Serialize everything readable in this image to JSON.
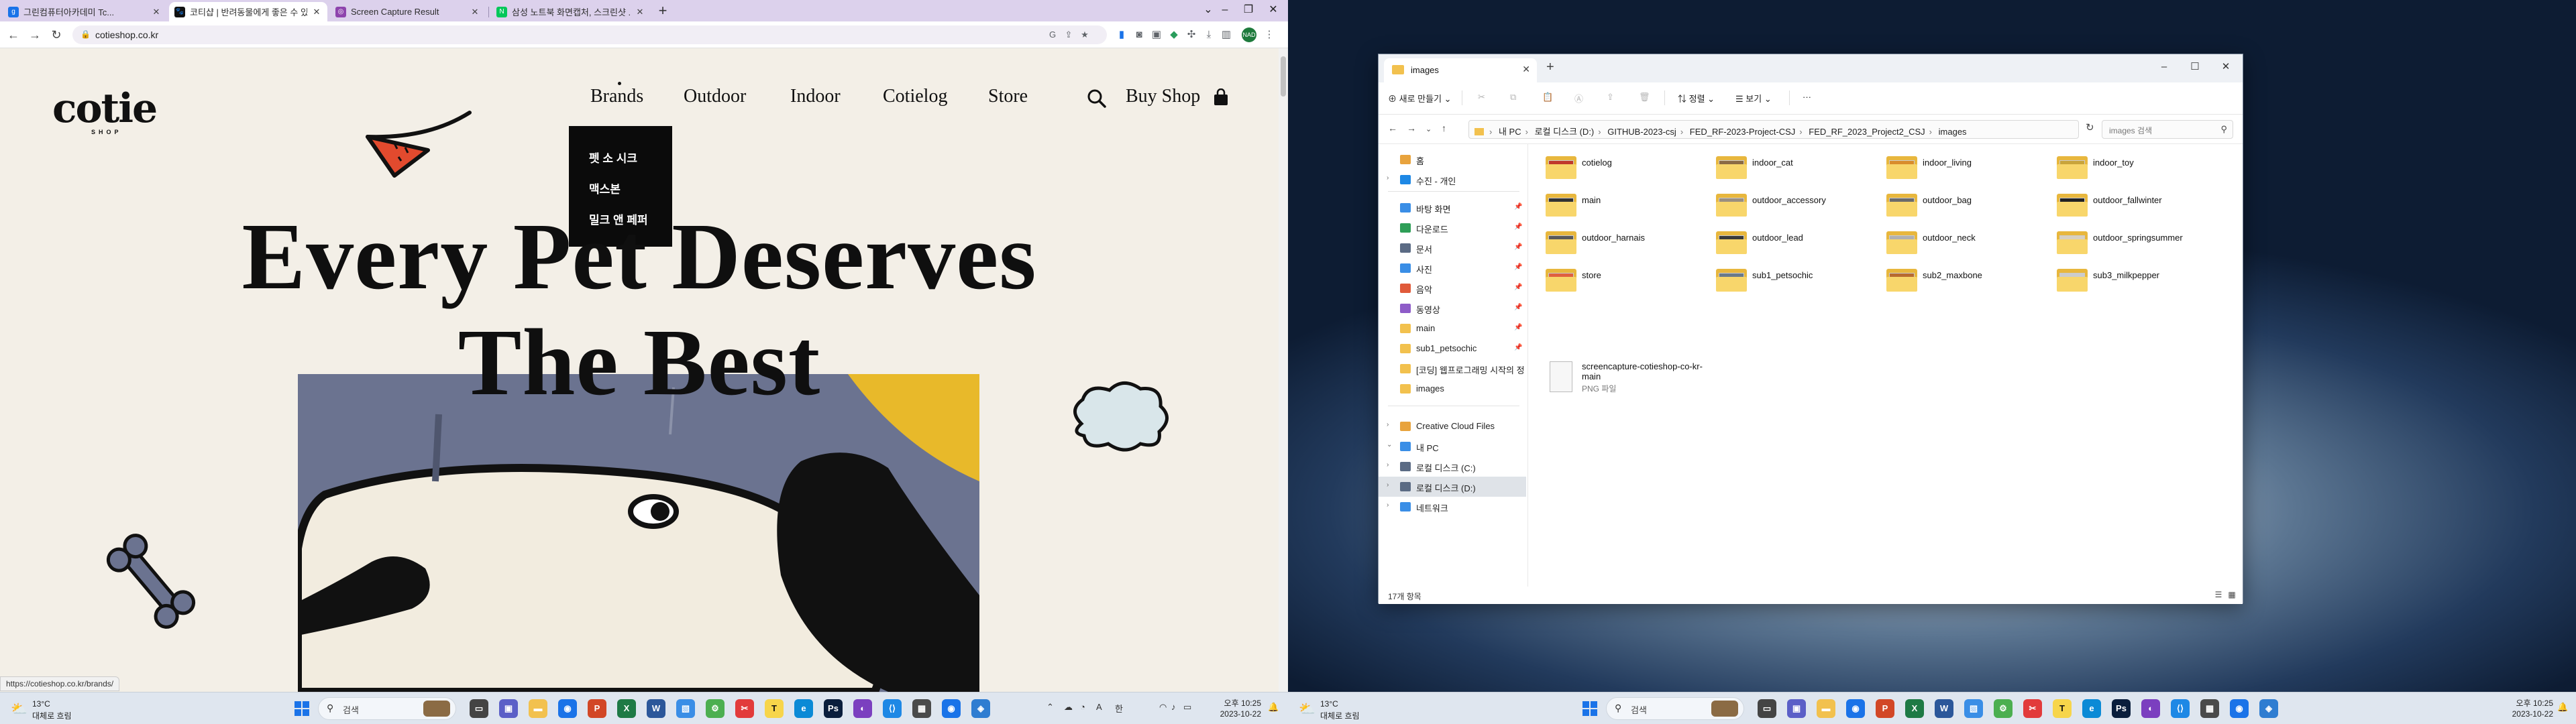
{
  "chrome": {
    "tabs": [
      {
        "title": "그린컴퓨터아카데미 Tc...",
        "icon_color": "#1a73e8"
      },
      {
        "title": "코티샵 | 반려동물에게 좋은 수 있...",
        "icon_color": "#111111"
      },
      {
        "title": "Screen Capture Result",
        "icon_color": "#8e44ad"
      },
      {
        "title": "삼성 노트북 화면캡처, 스크린샷 ...",
        "icon_color": "#03c75a"
      }
    ],
    "active_tab": 1,
    "url": "cotieshop.co.kr",
    "profile_initials": "NAD",
    "status_url": "https://cotieshop.co.kr/brands/"
  },
  "site": {
    "logo_word": "cotie",
    "logo_sub": "SHOP",
    "nav": [
      "Brands",
      "Outdoor",
      "Indoor",
      "Cotielog",
      "Store"
    ],
    "buy_label": "Buy Shop",
    "brands_dropdown": [
      "펫 소 시크",
      "맥스본",
      "밀크 앤 페퍼"
    ],
    "hero_line1": "Every Pet Deserves",
    "hero_line2": "The Best",
    "accent_colors": {
      "navy": "#6b7390",
      "yellow": "#e8b92a",
      "cream": "#f2ecdf"
    }
  },
  "taskbar_left": {
    "weather_temp": "13°C",
    "weather_text": "대체로 흐림",
    "search_placeholder": "검색",
    "time": "오후 10:25",
    "date": "2023-10-22",
    "ime": "한"
  },
  "taskbar_right": {
    "weather_temp": "13°C",
    "weather_text": "대체로 흐림",
    "search_placeholder": "검색",
    "time": "오후 10:25",
    "date": "2023-10-22"
  },
  "explorer": {
    "tab_title": "images",
    "commands": {
      "new": "새로 만들기",
      "sort": "정렬",
      "view": "보기",
      "more": "···"
    },
    "breadcrumbs": [
      "내 PC",
      "로컬 디스크 (D:)",
      "GITHUB-2023-csj",
      "FED_RF-2023-Project-CSJ",
      "FED_RF_2023_Project2_CSJ",
      "images"
    ],
    "search_placeholder": "images 검색",
    "nav_items": [
      {
        "label": "홈",
        "icon": "home-icon",
        "color": "#e8a33d",
        "pin": false,
        "chev": false
      },
      {
        "label": "수진 - 개인",
        "icon": "cloud-icon",
        "color": "#1e88e5",
        "pin": false,
        "chev": true
      },
      {
        "label": "바탕 화면",
        "icon": "desktop-icon",
        "color": "#3a8ee6",
        "pin": true,
        "chev": false
      },
      {
        "label": "다운로드",
        "icon": "download-icon",
        "color": "#2e9e57",
        "pin": true,
        "chev": false
      },
      {
        "label": "문서",
        "icon": "document-icon",
        "color": "#5b6b84",
        "pin": true,
        "chev": false
      },
      {
        "label": "사진",
        "icon": "photo-icon",
        "color": "#3a8ee6",
        "pin": true,
        "chev": false
      },
      {
        "label": "음악",
        "icon": "music-icon",
        "color": "#e05a3a",
        "pin": true,
        "chev": false
      },
      {
        "label": "동영상",
        "icon": "video-icon",
        "color": "#8e5cc8",
        "pin": true,
        "chev": false
      },
      {
        "label": "main",
        "icon": "folder-icon",
        "color": "#f2c14e",
        "pin": true,
        "chev": false
      },
      {
        "label": "sub1_petsochic",
        "icon": "folder-icon",
        "color": "#f2c14e",
        "pin": true,
        "chev": false
      },
      {
        "label": "[코딩] 웹프로그래밍 시작의 정",
        "icon": "folder-icon",
        "color": "#f2c14e",
        "pin": false,
        "chev": false
      },
      {
        "label": "images",
        "icon": "folder-icon",
        "color": "#f2c14e",
        "pin": false,
        "chev": false
      },
      {
        "label": "Creative Cloud Files",
        "icon": "cloud-folder-icon",
        "color": "#e8a33d",
        "pin": false,
        "chev": true
      },
      {
        "label": "내 PC",
        "icon": "pc-icon",
        "color": "#3a8ee6",
        "pin": false,
        "chev": true
      },
      {
        "label": "로컬 디스크 (C:)",
        "icon": "drive-icon",
        "color": "#5b6b84",
        "pin": false,
        "chev": true
      },
      {
        "label": "로컬 디스크 (D:)",
        "icon": "drive-icon",
        "color": "#5b6b84",
        "pin": false,
        "chev": true
      },
      {
        "label": "네트워크",
        "icon": "network-icon",
        "color": "#3a8ee6",
        "pin": false,
        "chev": true
      }
    ],
    "files": [
      "cotielog",
      "indoor_cat",
      "indoor_living",
      "indoor_toy",
      "main",
      "outdoor_accessory",
      "outdoor_bag",
      "outdoor_fallwinter",
      "outdoor_harnais",
      "outdoor_lead",
      "outdoor_neck",
      "outdoor_springsummer",
      "store",
      "sub1_petsochic",
      "sub2_maxbone",
      "sub3_milkpepper"
    ],
    "png_file": {
      "name": "screencapture-cotieshop-co-kr-main",
      "type": "PNG 파일"
    },
    "item_count": "17개 항목"
  }
}
